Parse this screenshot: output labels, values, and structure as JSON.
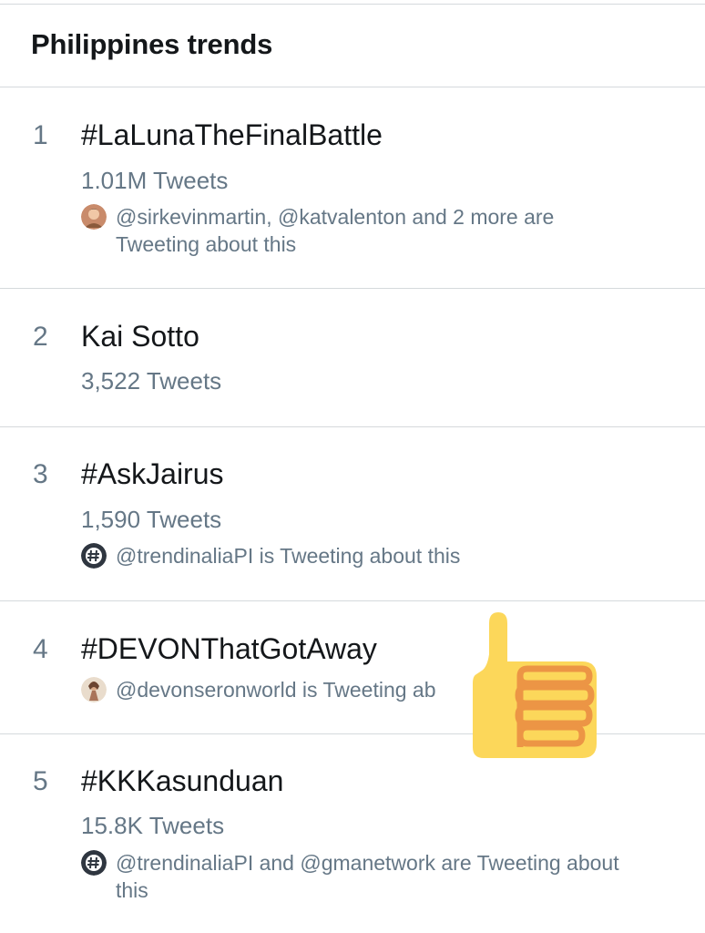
{
  "header": {
    "title": "Philippines trends"
  },
  "trends": [
    {
      "rank": "1",
      "name": "#LaLunaTheFinalBattle",
      "tweets": "1.01M Tweets",
      "context": "@sirkevinmartin, @katvalenton and 2 more are Tweeting about this",
      "avatar_icon": "user-photo-avatar"
    },
    {
      "rank": "2",
      "name": "Kai Sotto",
      "tweets": "3,522 Tweets"
    },
    {
      "rank": "3",
      "name": "#AskJairus",
      "tweets": "1,590 Tweets",
      "context": "@trendinaliaPI is Tweeting about this",
      "avatar_icon": "hashtag-avatar"
    },
    {
      "rank": "4",
      "name": "#DEVONThatGotAway",
      "context": "@devonseronworld is Tweeting ab",
      "avatar_icon": "user-photo-avatar"
    },
    {
      "rank": "5",
      "name": "#KKKasunduan",
      "tweets": "15.8K Tweets",
      "context": "@trendinaliaPI and @gmanetwork are Tweeting about this",
      "avatar_icon": "hashtag-avatar"
    }
  ],
  "overlay": {
    "icon": "thumbs-up-emoji",
    "colors": {
      "fill": "#fcd75a",
      "lines": "#ec9545"
    }
  },
  "colors": {
    "primary_text": "#14171a",
    "secondary_text": "#657786",
    "divider": "#d5d9dc"
  }
}
